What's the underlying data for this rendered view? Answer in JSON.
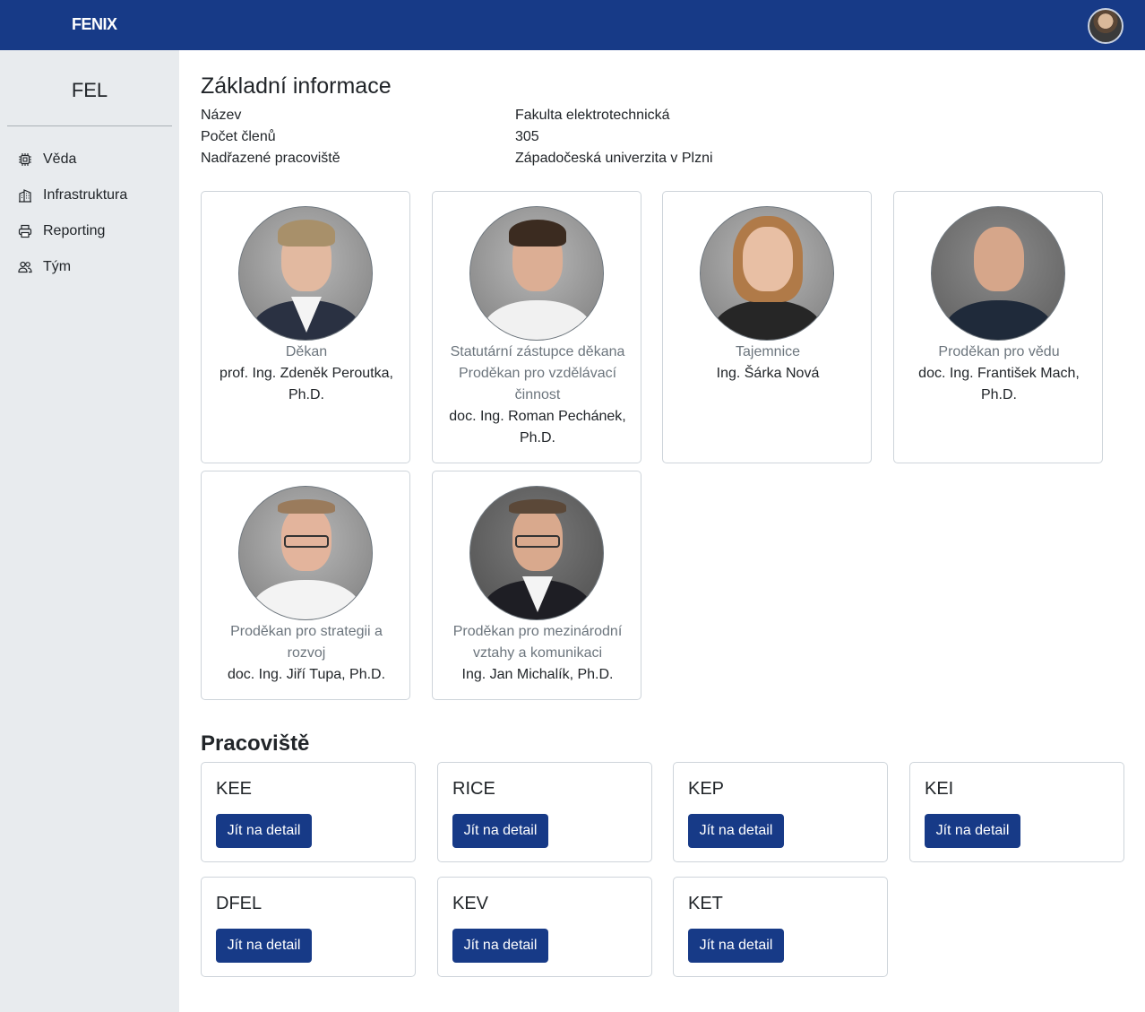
{
  "app": {
    "logo": "FENIX"
  },
  "sidebar": {
    "title": "FEL",
    "items": [
      {
        "label": "Věda",
        "icon": "cpu-icon"
      },
      {
        "label": "Infrastruktura",
        "icon": "buildings-icon"
      },
      {
        "label": "Reporting",
        "icon": "printer-icon"
      },
      {
        "label": "Tým",
        "icon": "people-icon"
      }
    ]
  },
  "info": {
    "heading": "Základní informace",
    "rows": [
      {
        "key": "Název",
        "value": "Fakulta elektrotechnická"
      },
      {
        "key": "Počet členů",
        "value": "305"
      },
      {
        "key": "Nadřazené pracoviště",
        "value": "Západočeská univerzita v Plzni"
      }
    ]
  },
  "people": [
    {
      "role": "Děkan",
      "name": "prof. Ing. Zdeněk Peroutka, Ph.D."
    },
    {
      "role": "Statutární zástupce děkana Proděkan pro vzdělávací činnost",
      "name": "doc. Ing. Roman Pechánek, Ph.D."
    },
    {
      "role": "Tajemnice",
      "name": "Ing. Šárka Nová"
    },
    {
      "role": "Proděkan pro vědu",
      "name": "doc. Ing. František Mach, Ph.D."
    },
    {
      "role": "Proděkan pro strategii a rozvoj",
      "name": "doc. Ing. Jiří Tupa, Ph.D."
    },
    {
      "role": "Proděkan pro mezinárodní vztahy a komunikaci",
      "name": "Ing. Jan Michalík, Ph.D."
    }
  ],
  "workplaces": {
    "heading": "Pracoviště",
    "button_label": "Jít na detail",
    "items": [
      "KEE",
      "RICE",
      "KEP",
      "KEI",
      "DFEL",
      "KEV",
      "KET"
    ]
  },
  "colors": {
    "primary": "#173a87",
    "sidebar_bg": "#e8ebee",
    "muted_text": "#6c757d"
  }
}
